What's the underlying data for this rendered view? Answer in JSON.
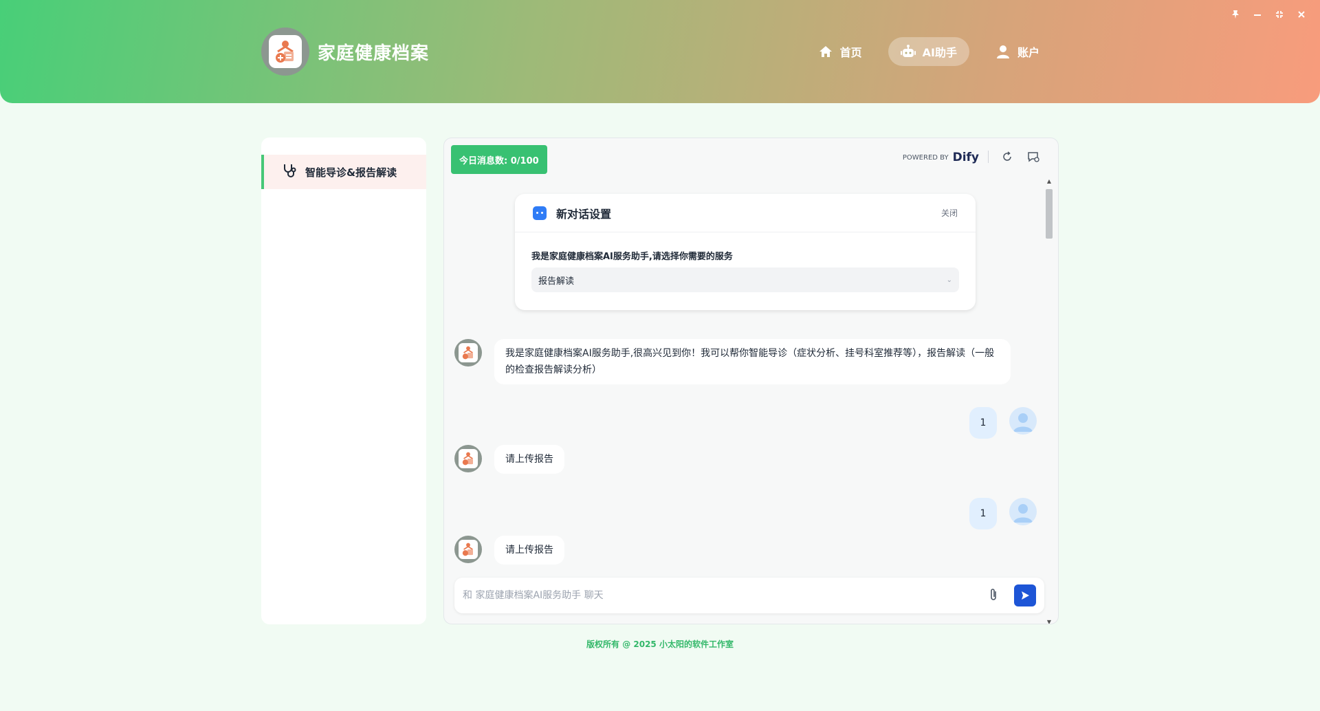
{
  "window_controls": {
    "pin": "🖈",
    "minimize": "—",
    "restore": "⤧",
    "close": "✕"
  },
  "brand": {
    "title": "家庭健康档案"
  },
  "nav": {
    "items": [
      {
        "label": "首页",
        "icon": "home-icon"
      },
      {
        "label": "AI助手",
        "icon": "robot-icon",
        "active": true
      },
      {
        "label": "账户",
        "icon": "user-icon"
      }
    ]
  },
  "sidebar": {
    "items": [
      {
        "label": "智能导诊&报告解读",
        "icon": "stethoscope-icon",
        "active": true
      }
    ]
  },
  "chat": {
    "quota": "今日消息数: 0/100",
    "powered_by": "POWERED BY",
    "brand_logo": "Dify",
    "settings": {
      "title": "新对话设置",
      "close": "关闭",
      "label": "我是家庭健康档案AI服务助手,请选择你需要的服务",
      "selected": "报告解读"
    },
    "messages": [
      {
        "role": "bot",
        "text": "我是家庭健康档案AI服务助手,很高兴见到你！我可以帮你智能导诊（症状分析、挂号科室推荐等），报告解读（一般的检查报告解读分析）"
      },
      {
        "role": "user",
        "text": "1"
      },
      {
        "role": "bot",
        "text": "请上传报告"
      },
      {
        "role": "user",
        "text": "1"
      },
      {
        "role": "bot",
        "text": "请上传报告"
      }
    ],
    "composer": {
      "placeholder": "和 家庭健康档案AI服务助手 聊天"
    }
  },
  "footer": {
    "copyright": "版权所有 @ 2025 小太阳的软件工作室"
  },
  "colors": {
    "accent_green": "#38c172",
    "send_blue": "#1d55d6",
    "user_bubble": "#e1effe"
  }
}
